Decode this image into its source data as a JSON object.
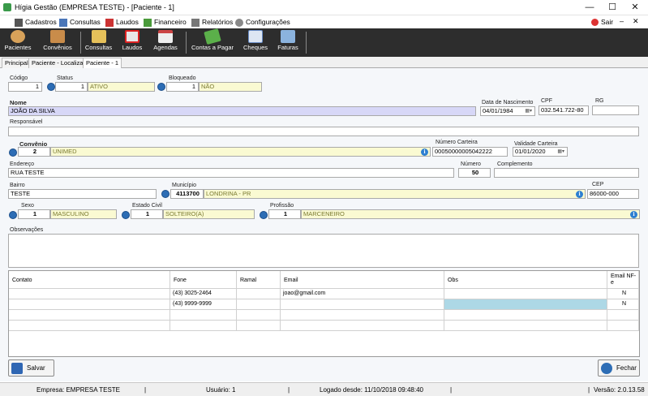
{
  "window": {
    "title": "Hígia Gestão (EMPRESA TESTE) - [Paciente - 1]",
    "minimize": "—",
    "maximize": "☐",
    "close": "✕"
  },
  "menu": {
    "items": [
      "Cadastros",
      "Consultas",
      "Laudos",
      "Financeiro",
      "Relatórios",
      "Configurações"
    ],
    "exit": "Sair"
  },
  "toolbar": {
    "buttons": [
      "Pacientes",
      "Convênios",
      "Consultas",
      "Laudos",
      "Agendas",
      "Contas a Pagar",
      "Cheques",
      "Faturas"
    ]
  },
  "tabs": [
    "Principal",
    "Paciente - Localizar",
    "Paciente - 1"
  ],
  "form": {
    "codigo": {
      "label": "Código",
      "value": "1"
    },
    "status": {
      "label": "Status",
      "code": "1",
      "desc": "ATIVO"
    },
    "bloqueado": {
      "label": "Bloqueado",
      "code": "1",
      "desc": "NÃO"
    },
    "nome": {
      "label": "Nome",
      "value": "JOÃO DA SILVA"
    },
    "data_nascimento": {
      "label": "Data de Nascimento",
      "value": "04/01/1984"
    },
    "cpf": {
      "label": "CPF",
      "value": "032.541.722-80"
    },
    "rg": {
      "label": "RG",
      "value": ""
    },
    "responsavel": {
      "label": "Responsável",
      "value": ""
    },
    "convenio": {
      "label": "Convênio",
      "code": "2",
      "desc": "UNIMED"
    },
    "numero_carteira": {
      "label": "Número Carteira",
      "value": "00050000005042222"
    },
    "validade_carteira": {
      "label": "Validade Carteira",
      "value": "01/01/2020"
    },
    "endereco": {
      "label": "Endereço",
      "value": "RUA TESTE"
    },
    "numero": {
      "label": "Número",
      "value": "50"
    },
    "complemento": {
      "label": "Complemento",
      "value": ""
    },
    "bairro": {
      "label": "Bairro",
      "value": "TESTE"
    },
    "municipio": {
      "label": "Município",
      "code": "4113700",
      "desc": "LONDRINA - PR"
    },
    "cep": {
      "label": "CEP",
      "value": "86000-000"
    },
    "sexo": {
      "label": "Sexo",
      "code": "1",
      "desc": "MASCULINO"
    },
    "estado_civil": {
      "label": "Estado Civil",
      "code": "1",
      "desc": "SOLTEIRO(A)"
    },
    "profissao": {
      "label": "Profissão",
      "code": "1",
      "desc": "MARCENEIRO"
    },
    "observacoes": {
      "label": "Observações",
      "value": ""
    }
  },
  "contacts": {
    "headers": [
      "Contato",
      "Fone",
      "Ramal",
      "Email",
      "Obs",
      "Email NF-e"
    ],
    "rows": [
      [
        "",
        "(43) 3025-2464",
        "",
        "joao@gmail.com",
        "",
        "N"
      ],
      [
        "",
        "(43) 9999-9999",
        "",
        "",
        "",
        "N"
      ],
      [
        "",
        "",
        "",
        "",
        "",
        ""
      ],
      [
        "",
        "",
        "",
        "",
        "",
        ""
      ]
    ]
  },
  "buttons": {
    "save": "Salvar",
    "close": "Fechar"
  },
  "status": {
    "empresa": "Empresa: EMPRESA TESTE",
    "usuario": "Usuário: 1",
    "logado": "Logado desde: 11/10/2018 09:48:40",
    "versao": "Versão: 2.0.13.58",
    "sep": "|"
  },
  "colors": {
    "toolbar": "#2d2d2d",
    "yellow_field": "#fafad2",
    "name_field": "#d7d7f7",
    "obs_highlight": "#add8e6"
  }
}
